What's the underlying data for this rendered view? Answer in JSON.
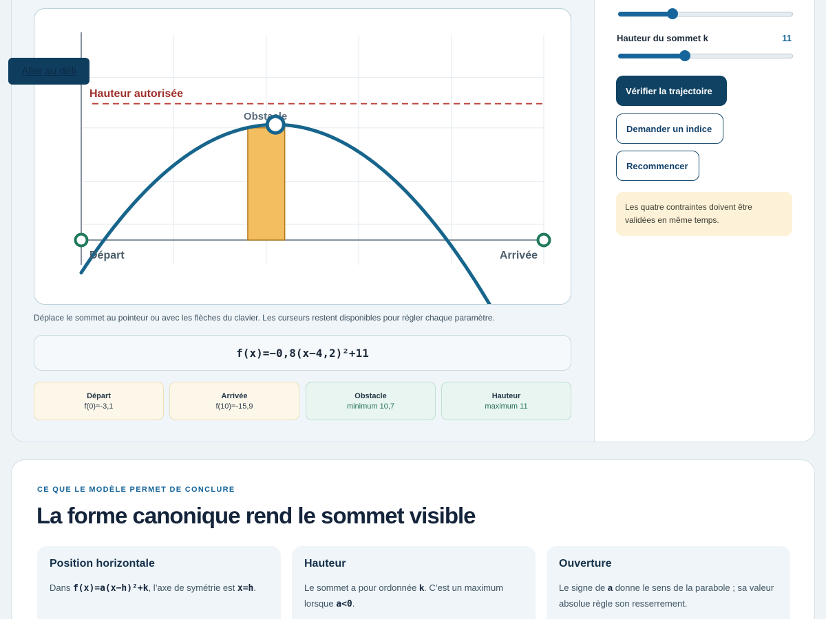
{
  "skip_link": "Aller au défi",
  "graph": {
    "height_label": "Hauteur autorisée",
    "obstacle_label": "Obstacle",
    "start_label": "Départ",
    "end_label": "Arrivée",
    "curve": {
      "a": -0.8,
      "h": 4.2,
      "k": 11
    },
    "x_range": [
      0,
      10
    ],
    "y_range": [
      -5,
      17
    ],
    "max_height": 13,
    "obstacle": {
      "x_from": 3.6,
      "x_to": 4.4,
      "height": 10.7
    },
    "colors": {
      "curve": "#17658c",
      "limit": "#c0453f",
      "obstacle": "#f3be60",
      "points": "#1f7a5c"
    }
  },
  "hint_text": "Déplace le sommet au pointeur ou avec les flèches du clavier. Les curseurs restent disponibles pour régler chaque paramètre.",
  "formula": "f(x)=−0,8(x−4,2)²+11",
  "constraints": [
    {
      "title": "Départ",
      "value": "f(0)=-3,1",
      "status": "warn"
    },
    {
      "title": "Arrivée",
      "value": "f(10)=-15,9",
      "status": "warn"
    },
    {
      "title": "Obstacle",
      "value": "minimum 10,7",
      "status": "ok"
    },
    {
      "title": "Hauteur",
      "value": "maximum 11",
      "status": "ok"
    }
  ],
  "sliders": {
    "h_fraction": 0.31,
    "k_label": "Hauteur du sommet k",
    "k_value": "11",
    "k_fraction": 0.38
  },
  "buttons": {
    "verify": "Vérifier la trajectoire",
    "hint": "Demander un indice",
    "reset": "Recommencer"
  },
  "note": "Les quatre contraintes doivent être validées en même temps.",
  "conclusion": {
    "eyebrow": "CE QUE LE MODÈLE PERMET DE CONCLURE",
    "title": "La forme canonique rend le sommet visible",
    "cards": [
      {
        "title": "Position horizontale",
        "pre": "Dans ",
        "code1": "f(x)=a(x−h)²+k",
        "mid": ", l’axe de symétrie est ",
        "code2": "x=h",
        "post": "."
      },
      {
        "title": "Hauteur",
        "pre": "Le sommet a pour ordonnée ",
        "b1": "k",
        "mid": ". C’est un maximum lorsque ",
        "code1": "a<0",
        "post": "."
      },
      {
        "title": "Ouverture",
        "pre": "Le signe de ",
        "b1": "a",
        "post": " donne le sens de la parabole ; sa valeur absolue règle son resserrement."
      }
    ]
  }
}
